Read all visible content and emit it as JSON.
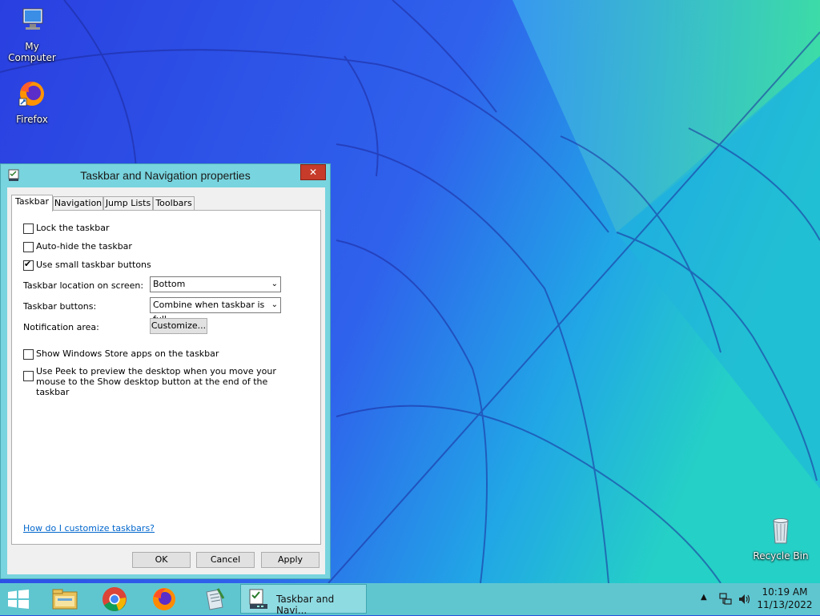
{
  "desktop": {
    "icons": [
      {
        "label": "My Computer",
        "icon": "computer-icon"
      },
      {
        "label": "Firefox",
        "icon": "firefox-icon"
      },
      {
        "label": "Recycle Bin",
        "icon": "recycle-bin-icon"
      }
    ]
  },
  "dialog": {
    "title": "Taskbar and Navigation properties",
    "close_label": "✕",
    "tabs": [
      {
        "label": "Taskbar",
        "active": true
      },
      {
        "label": "Navigation"
      },
      {
        "label": "Jump Lists"
      },
      {
        "label": "Toolbars"
      }
    ],
    "checkboxes": {
      "lock": {
        "label": "Lock the taskbar",
        "checked": false
      },
      "autohide": {
        "label": "Auto-hide the taskbar",
        "checked": false
      },
      "small_buttons": {
        "label": "Use small taskbar buttons",
        "checked": true
      },
      "store_apps": {
        "label": "Show Windows Store apps on the taskbar",
        "checked": false
      },
      "peek": {
        "label": "Use Peek to preview the desktop when you move your mouse to the Show desktop button at the end of the taskbar",
        "checked": false
      }
    },
    "location": {
      "label": "Taskbar location on screen:",
      "value": "Bottom"
    },
    "buttons": {
      "label": "Taskbar buttons:",
      "value": "Combine when taskbar is full"
    },
    "notification": {
      "label": "Notification area:",
      "button": "Customize..."
    },
    "help_link": "How do I customize taskbars?",
    "ok": "OK",
    "cancel": "Cancel",
    "apply": "Apply"
  },
  "taskbar": {
    "pinned": [
      "start-icon",
      "file-explorer-icon",
      "chrome-icon",
      "firefox-icon",
      "notepad-icon"
    ],
    "active_task": "Taskbar and Navi...",
    "time": "10:19 AM",
    "date": "11/13/2022"
  },
  "colors": {
    "taskbar": "#5fc6d0",
    "dialog_frame": "#78d4de",
    "close_button": "#c73b2a",
    "link": "#0066cc"
  }
}
